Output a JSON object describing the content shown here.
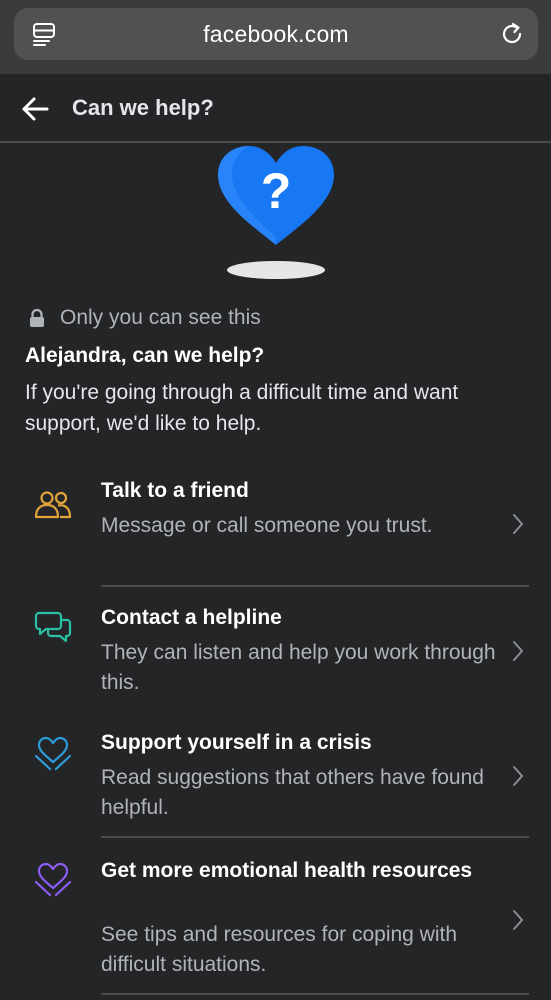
{
  "browser": {
    "url": "facebook.com",
    "tabs_icon": "tabs-icon",
    "reload_icon": "reload-icon"
  },
  "header": {
    "title": "Can we help?",
    "back_icon": "back-arrow-icon"
  },
  "illustration": {
    "icon": "heart-question-icon",
    "heart_color": "#1877f2"
  },
  "intro": {
    "privacy": "Only you can see this",
    "greeting": "Alejandra, can we help?",
    "body": "If you're going through a difficult time and want support, we'd like to help."
  },
  "options": [
    {
      "title": "Talk to a friend",
      "description": "Message or call someone you trust.",
      "icon": "people-icon",
      "color": "#e2a33a"
    },
    {
      "title": "Contact a helpline",
      "description": "They can listen and help you work through this.",
      "icon": "chat-bubbles-icon",
      "color": "#2bbfa4"
    },
    {
      "title": "Support yourself in a crisis",
      "description": "Read suggestions that others have found helpful.",
      "icon": "heart-hands-icon",
      "color": "#2d9cdb"
    },
    {
      "title": "Get more emotional health resources",
      "description": "See tips and resources for coping with difficult situations.",
      "icon": "heart-hands-icon",
      "color": "#8b5cf6"
    }
  ],
  "colors": {
    "background": "#242526",
    "text_primary": "#e4e6eb",
    "text_secondary": "#b0b3b8",
    "divider": "#4a4b4d"
  }
}
